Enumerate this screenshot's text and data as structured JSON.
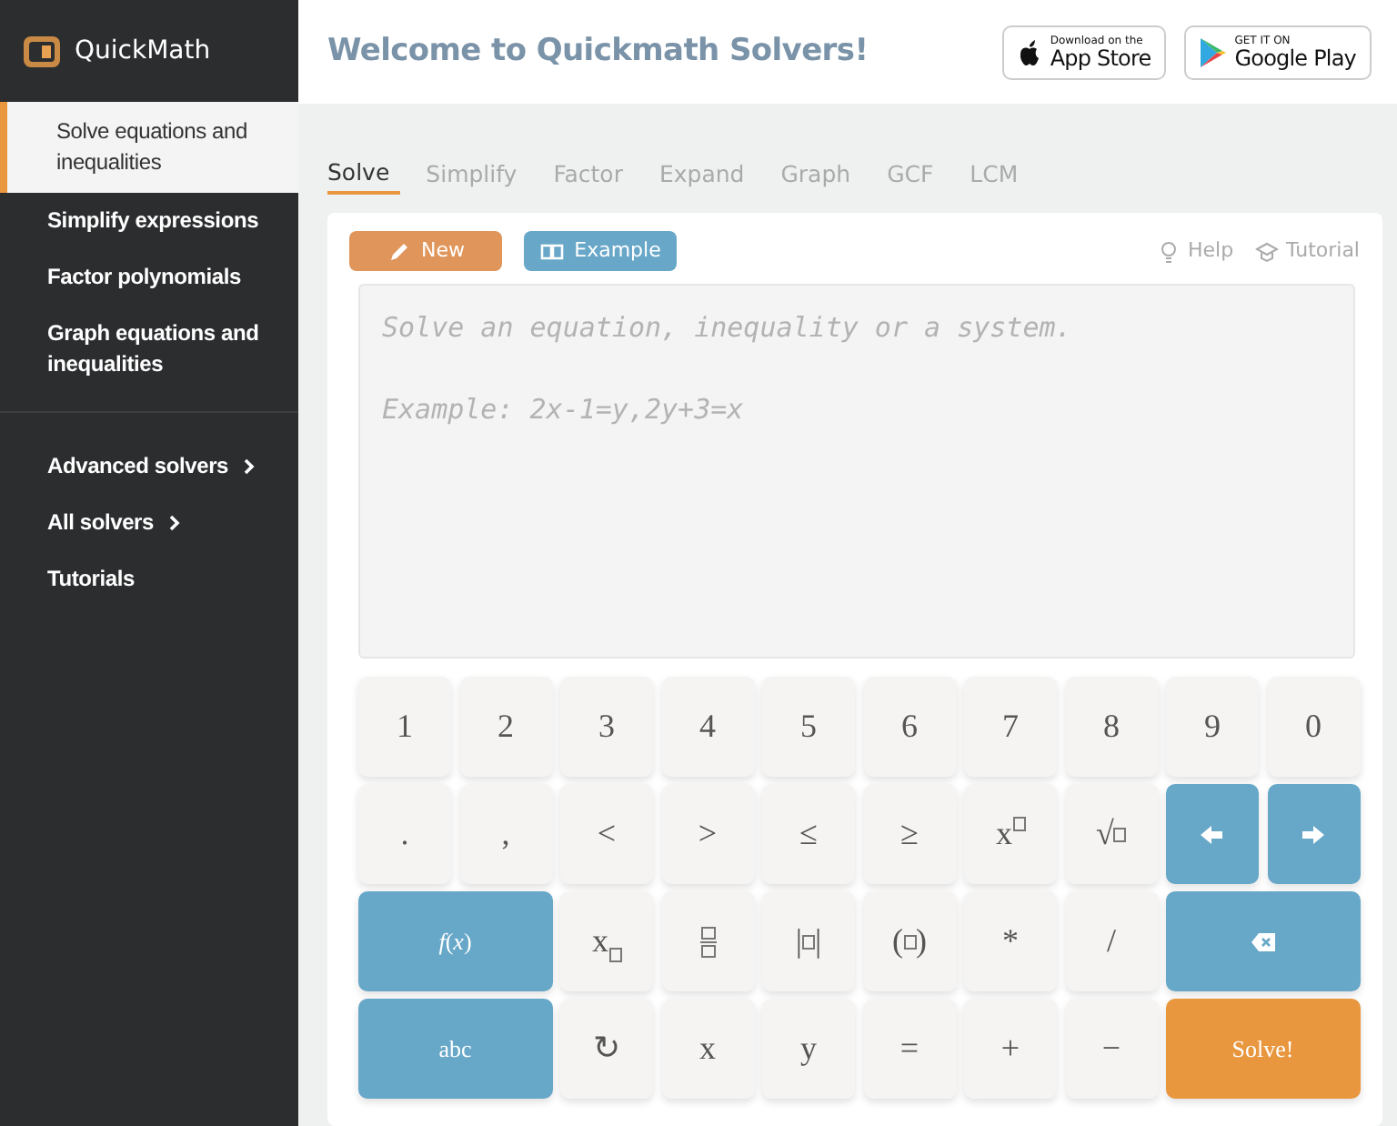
{
  "brand": {
    "name": "QuickMath"
  },
  "sidebar": {
    "groups": [
      {
        "items": [
          {
            "label": "Solve equations and inequalities",
            "selected": true,
            "expandable": false
          },
          {
            "label": "Simplify expressions",
            "selected": false,
            "expandable": false
          },
          {
            "label": "Factor polynomials",
            "selected": false,
            "expandable": false
          },
          {
            "label": "Graph equations and inequalities",
            "selected": false,
            "expandable": false
          }
        ]
      },
      {
        "items": [
          {
            "label": "Advanced solvers",
            "selected": false,
            "expandable": true
          },
          {
            "label": "All solvers",
            "selected": false,
            "expandable": true
          },
          {
            "label": "Tutorials",
            "selected": false,
            "expandable": false
          }
        ]
      }
    ]
  },
  "header": {
    "title": "Welcome to Quickmath Solvers!",
    "stores": [
      {
        "kind": "apple",
        "small": "Download on the",
        "big": "App Store"
      },
      {
        "kind": "google",
        "small": "GET IT ON",
        "big": "Google Play"
      }
    ]
  },
  "tabs": [
    {
      "label": "Solve",
      "selected": true
    },
    {
      "label": "Simplify",
      "selected": false
    },
    {
      "label": "Factor",
      "selected": false
    },
    {
      "label": "Expand",
      "selected": false
    },
    {
      "label": "Graph",
      "selected": false
    },
    {
      "label": "GCF",
      "selected": false
    },
    {
      "label": "LCM",
      "selected": false
    }
  ],
  "toolbar": {
    "buttons": [
      {
        "label": "New",
        "color": "#e0955a"
      },
      {
        "label": "Example",
        "color": "#68a7c8"
      }
    ],
    "links": [
      {
        "label": "Help"
      },
      {
        "label": "Tutorial"
      }
    ]
  },
  "input": {
    "placeholder": "Solve an equation, inequality or a system.\n\nExample: 2x-1=y,2y+3=x"
  },
  "keypad": {
    "keys": [
      {
        "kind": "text",
        "label": "1"
      },
      {
        "kind": "text",
        "label": "2"
      },
      {
        "kind": "text",
        "label": "3"
      },
      {
        "kind": "text",
        "label": "4"
      },
      {
        "kind": "text",
        "label": "5"
      },
      {
        "kind": "text",
        "label": "6"
      },
      {
        "kind": "text",
        "label": "7"
      },
      {
        "kind": "text",
        "label": "8"
      },
      {
        "kind": "text",
        "label": "9"
      },
      {
        "kind": "text",
        "label": "0"
      },
      {
        "kind": "text",
        "label": "."
      },
      {
        "kind": "text",
        "label": ","
      },
      {
        "kind": "text",
        "label": "<"
      },
      {
        "kind": "text",
        "label": ">"
      },
      {
        "kind": "text",
        "label": "≤"
      },
      {
        "kind": "text",
        "label": "≥"
      },
      {
        "kind": "sup",
        "label": "x"
      },
      {
        "kind": "after",
        "label": "√"
      },
      {
        "kind": "left"
      },
      {
        "kind": "right"
      },
      {
        "kind": "function",
        "label": "*f*(*x*)",
        "wide": true
      },
      {
        "kind": "sub",
        "label": "x"
      },
      {
        "kind": "fraction"
      },
      {
        "kind": "wrap",
        "left": "|",
        "right": "|"
      },
      {
        "kind": "wrap",
        "left": "(",
        "right": ")"
      },
      {
        "kind": "text",
        "label": "*"
      },
      {
        "kind": "text",
        "label": "/"
      },
      {
        "kind": "backspace",
        "wide": true
      },
      {
        "kind": "function",
        "label": "abc",
        "wide": true
      },
      {
        "kind": "text",
        "label": "↻"
      },
      {
        "kind": "text",
        "label": "x"
      },
      {
        "kind": "text",
        "label": "y"
      },
      {
        "kind": "text",
        "label": "="
      },
      {
        "kind": "text",
        "label": "+"
      },
      {
        "kind": "text",
        "label": "−"
      },
      {
        "kind": "submit",
        "label": "Solve!",
        "wide": true
      }
    ]
  }
}
